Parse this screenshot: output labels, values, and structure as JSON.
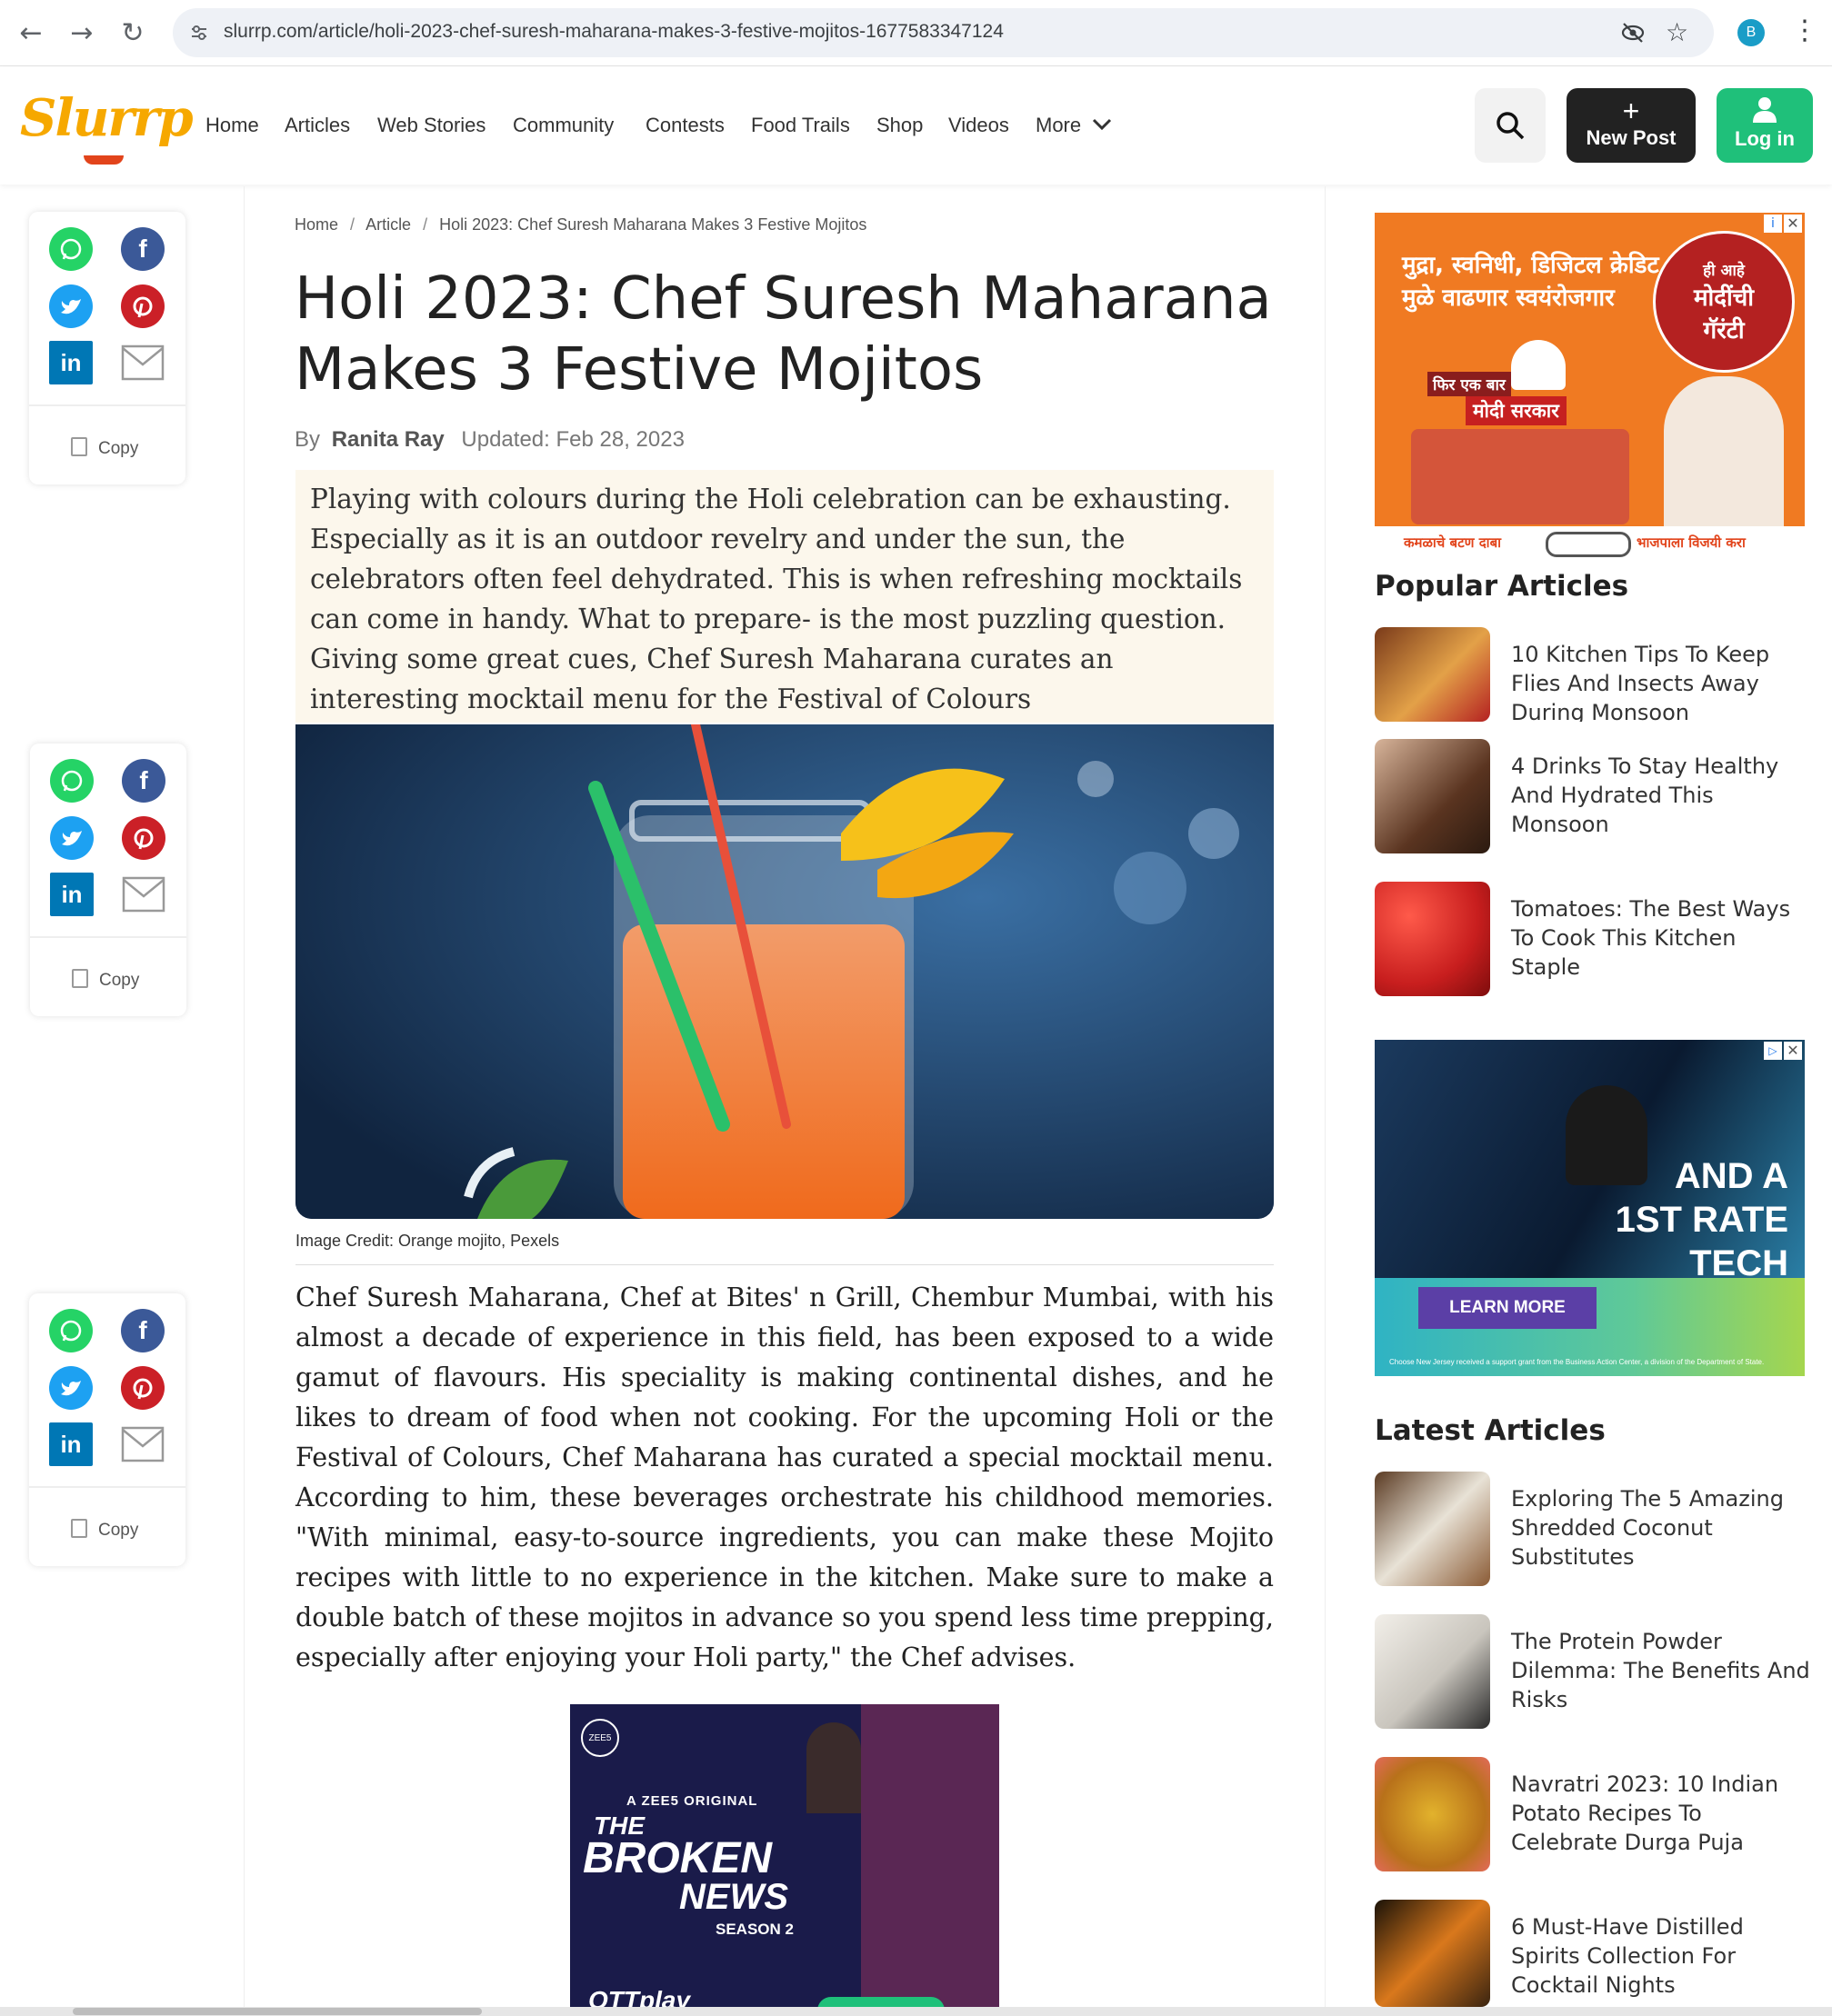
{
  "browser": {
    "url": "slurrp.com/article/holi-2023-chef-suresh-maharana-makes-3-festive-mojitos-1677583347124",
    "profile_initial": "B"
  },
  "site": {
    "logo_text": "Slurrp",
    "nav": [
      "Home",
      "Articles",
      "Web Stories",
      "Community",
      "Contests",
      "Food Trails",
      "Shop",
      "Videos",
      "More"
    ],
    "new_post_label": "New Post",
    "login_label": "Log in"
  },
  "share": {
    "copy_label": "Copy",
    "linkedin_text": "in",
    "facebook_text": "f"
  },
  "article": {
    "breadcrumb": [
      "Home",
      "Article",
      "Holi 2023: Chef Suresh Maharana Makes 3 Festive Mojitos"
    ],
    "title": "Holi 2023: Chef Suresh Maharana Makes 3 Festive Mojitos",
    "by_label": "By",
    "author": "Ranita Ray",
    "updated": "Updated: Feb 28, 2023",
    "summary": "Playing with colours during the Holi celebration can be exhausting. Especially as it is an outdoor revelry and under the sun, the celebrators often feel dehydrated. This is when refreshing mocktails can come in handy. What to prepare- is the most puzzling question. Giving some great cues, Chef Suresh Maharana curates an interesting mocktail menu for the Festival of Colours",
    "image_caption": "Image Credit: Orange mojito, Pexels",
    "body": "Chef Suresh Maharana, Chef at Bites' n Grill, Chembur Mumbai, with his almost a decade of experience in this field, has been exposed to a wide gamut of flavours. His speciality is making continental dishes, and he likes to dream of food when not cooking. For the upcoming Holi or the Festival of Colours, Chef Maharana has curated a special mocktail menu. According to him, these beverages orchestrate his childhood memories. \"With minimal, easy-to-source ingredients, you can make these Mojito recipes with little to no experience in the kitchen. Make sure to make a double batch of these mojitos in advance so you spend less time prepping, especially after enjoying your Holi party,\" the Chef advises."
  },
  "ads": {
    "top": {
      "headline_1": "मुद्रा, स्वनिधी, डिजिटल क्रेडिट",
      "headline_2": "मुळे वाढणार स्वयंरोजगार",
      "badge_1": "ही आहे",
      "badge_2": "मोदींची",
      "badge_3": "गॅरंटी",
      "tag_1": "फिर एक बार",
      "tag_2": "मोदी सरकार",
      "footer_left": "कमळाचे बटण दाबा",
      "footer_right": "भाजपाला विजयी करा"
    },
    "tech": {
      "line_1": "AND A",
      "line_2": "1ST RATE",
      "line_3": "TECH",
      "cta": "LEARN MORE",
      "fine_print": "Choose New Jersey received a support grant from the Business Action Center, a division of the Department of State."
    },
    "video": {
      "brand": "ZEE5",
      "kicker": "A ZEE5 ORIGINAL",
      "title_1": "THE",
      "title_2": "BROKEN",
      "title_3": "NEWS",
      "season": "SEASON 2",
      "footer": "OTTplay"
    }
  },
  "sidebar": {
    "popular_heading": "Popular Articles",
    "popular": [
      "10 Kitchen Tips To Keep Flies And Insects Away During Monsoon",
      "4 Drinks To Stay Healthy And Hydrated This Monsoon",
      "Tomatoes: The Best Ways To Cook This Kitchen Staple"
    ],
    "latest_heading": "Latest Articles",
    "latest": [
      "Exploring The 5 Amazing Shredded Coconut Substitutes",
      "The Protein Powder Dilemma: The Benefits And Risks",
      "Navratri 2023: 10 Indian Potato Recipes To Celebrate Durga Puja",
      "6 Must-Have Distilled Spirits Collection For Cocktail Nights"
    ]
  },
  "colors": {
    "brand_orange": "#f6a800",
    "login_green": "#1fc07a",
    "summary_bg": "#fcf7ec"
  }
}
